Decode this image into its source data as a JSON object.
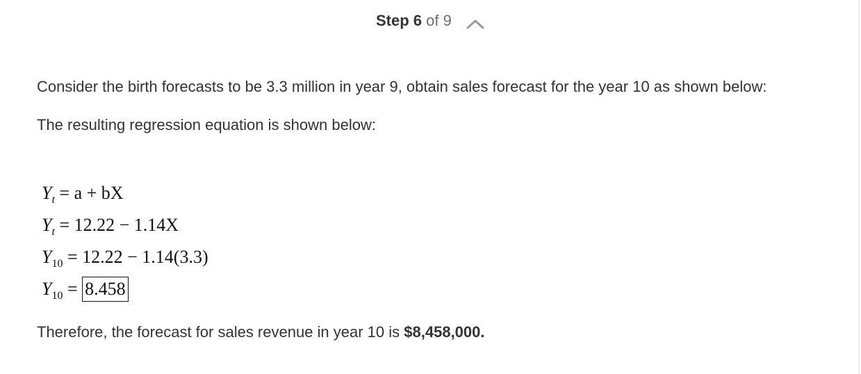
{
  "header": {
    "step_word": "Step",
    "step_number": "6",
    "of_total": "of 9",
    "collapse_icon": "chevron-up-icon"
  },
  "content": {
    "paragraph_1": "Consider the birth forecasts to be 3.3 million in year 9, obtain sales forecast for the year 10 as shown below:",
    "paragraph_2": "The resulting regression equation is shown below:",
    "equations": [
      {
        "lhs_var": "Y",
        "lhs_sub": "t",
        "rhs": "= a + bX"
      },
      {
        "lhs_var": "Y",
        "lhs_sub": "t",
        "rhs": "= 12.22 − 1.14X"
      },
      {
        "lhs_var": "Y",
        "lhs_sub": "10",
        "rhs": "= 12.22 − 1.14(3.3)"
      },
      {
        "lhs_var": "Y",
        "lhs_sub": "10",
        "rhs_prefix": "= ",
        "rhs_boxed": "8.458"
      }
    ],
    "conclusion_text": "Therefore, the forecast for sales revenue in year 10 is ",
    "conclusion_amount": "$8,458,000."
  }
}
